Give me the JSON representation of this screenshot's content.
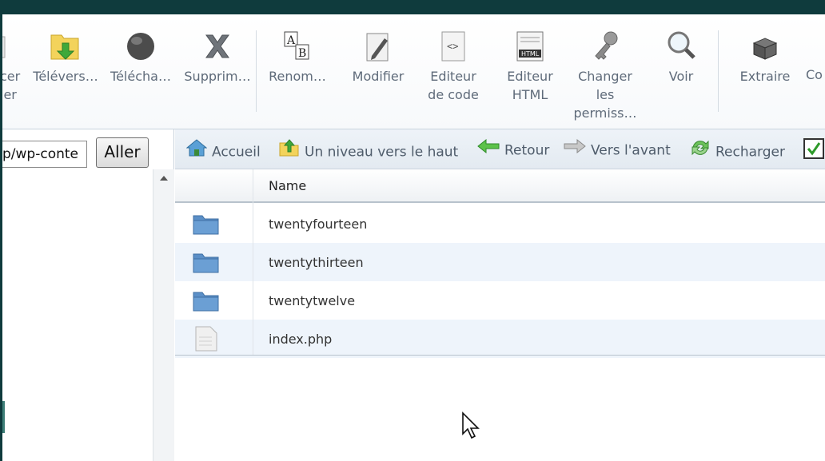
{
  "toolbar": {
    "items": [
      {
        "label": "cer\nier",
        "icon": "new-folder-icon"
      },
      {
        "label": "Télévers…",
        "icon": "upload-folder-icon"
      },
      {
        "label": "Télécha…",
        "icon": "download-globe-icon"
      },
      {
        "label": "Supprim…",
        "icon": "delete-x-icon"
      },
      {
        "label": "Renom…",
        "icon": "rename-ab-icon"
      },
      {
        "label": "Modifier",
        "icon": "edit-pencil-icon"
      },
      {
        "label": "Editeur\nde code",
        "icon": "code-editor-icon"
      },
      {
        "label": "Editeur\nHTML",
        "icon": "html-editor-icon"
      },
      {
        "label": "Changer\nles\npermiss…",
        "icon": "permissions-key-icon"
      },
      {
        "label": "Voir",
        "icon": "view-magnifier-icon"
      },
      {
        "label": "Extraire",
        "icon": "extract-box-icon"
      },
      {
        "label": "Co",
        "icon": "compress-icon"
      }
    ]
  },
  "path_bar": {
    "value": "p/wp-conte",
    "go_label": "Aller"
  },
  "nav": {
    "home": "Accueil",
    "up": "Un niveau vers le haut",
    "back": "Retour",
    "forward": "Vers l'avant",
    "reload": "Recharger"
  },
  "table": {
    "header_name": "Name",
    "rows": [
      {
        "name": "twentyfourteen",
        "type": "folder"
      },
      {
        "name": "twentythirteen",
        "type": "folder"
      },
      {
        "name": "twentytwelve",
        "type": "folder"
      },
      {
        "name": "index.php",
        "type": "file"
      }
    ]
  },
  "colors": {
    "top_bar": "#0f3b3d",
    "folder": "#5b8fc7",
    "row_alt": "#eef4fb"
  }
}
